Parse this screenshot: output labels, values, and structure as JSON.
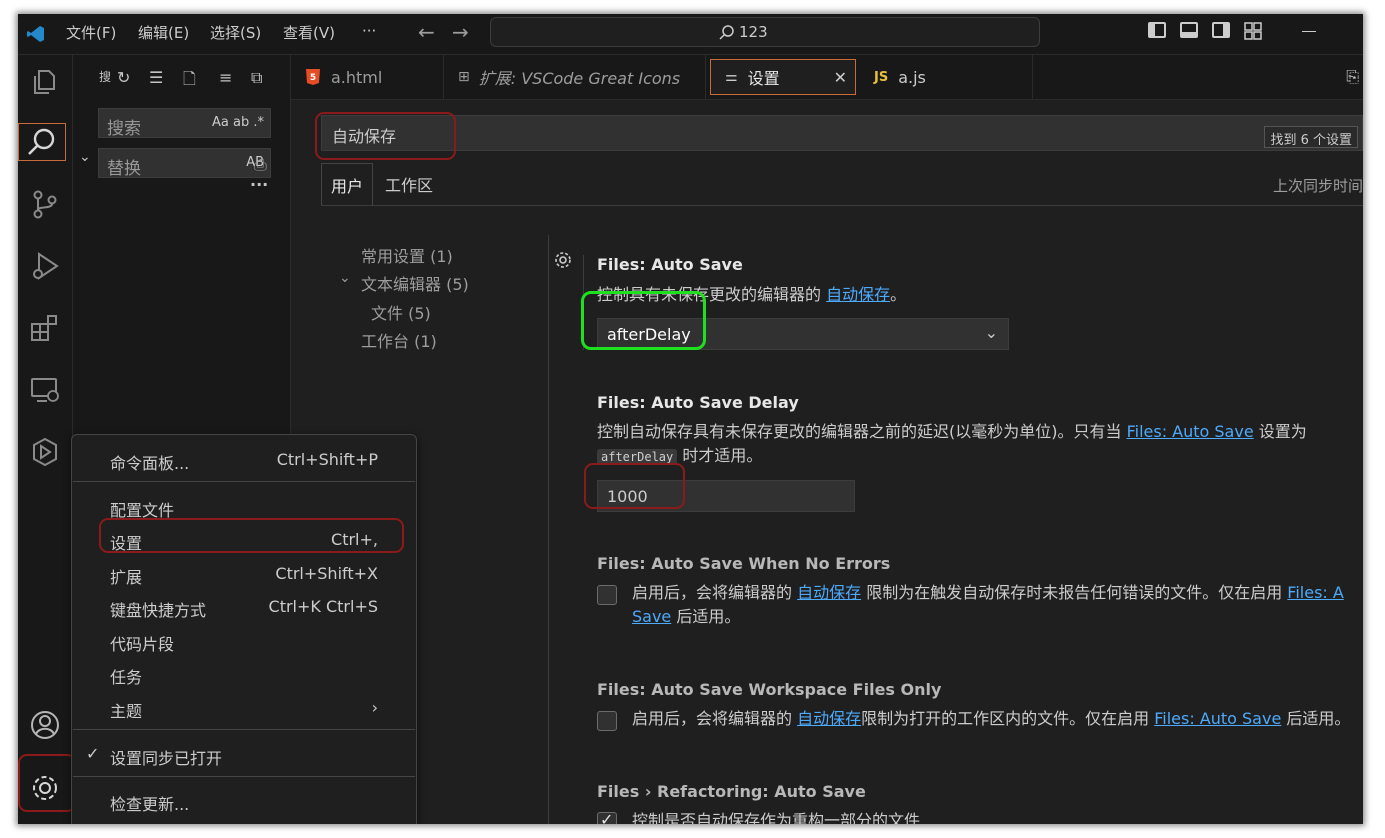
{
  "titlebar": {
    "menus": [
      "文件(F)",
      "编辑(E)",
      "选择(S)",
      "查看(V)",
      "···"
    ],
    "command_center": "123"
  },
  "sidebar": {
    "search_placeholder": "搜索",
    "search_options": "Aa  ab  .*",
    "replace_placeholder": "替换",
    "replace_option": "AB",
    "more": "···"
  },
  "tabs": [
    {
      "label": "a.html",
      "icon": "html5-icon"
    },
    {
      "label": "扩展: VSCode Great Icons",
      "icon": "extensions-icon"
    },
    {
      "label": "设置",
      "icon": "settings-sliders-icon",
      "close": "✕"
    },
    {
      "label": "a.js",
      "icon": "js-icon",
      "badge": "JS"
    }
  ],
  "settings": {
    "search_value": "自动保存",
    "found_count": "找到 6 个设置",
    "scope_tabs": [
      "用户",
      "工作区"
    ],
    "sync_text": "上次同步时间",
    "toc": [
      {
        "label": "常用设置 (1)"
      },
      {
        "label": "文本编辑器 (5)",
        "expanded": true
      },
      {
        "label": "文件 (5)"
      },
      {
        "label": "工作台 (1)"
      }
    ],
    "items": {
      "auto_save": {
        "title": "Files: Auto Save",
        "desc_prefix": "控制具有未保存更改的编辑器的 ",
        "desc_link": "自动保存",
        "desc_suffix": "。",
        "value": "afterDelay"
      },
      "auto_save_delay": {
        "title": "Files: Auto Save Delay",
        "desc_part1": "控制自动保存具有未保存更改的编辑器之前的延迟(以毫秒为单位)。只有当 ",
        "desc_link": "Files: Auto Save",
        "desc_part2": " 设置为",
        "desc_chip": "afterDelay",
        "desc_part3": " 时才适用。",
        "value": "1000"
      },
      "auto_save_no_errors": {
        "title": "Files: Auto Save When No Errors",
        "desc_part1": "启用后，会将编辑器的 ",
        "desc_link1": "自动保存",
        "desc_part2": " 限制为在触发自动保存时未报告任何错误的文件。仅在启用 ",
        "desc_link2a": "Files: A",
        "desc_link2b": "Save",
        "desc_part3": " 后适用。",
        "checked": false
      },
      "auto_save_workspace": {
        "title": "Files: Auto Save Workspace Files Only",
        "desc_part1": "启用后，会将编辑器的 ",
        "desc_link1": "自动保存",
        "desc_part2": "限制为打开的工作区内的文件。仅在启用 ",
        "desc_link2": "Files: Auto Save",
        "desc_part3": " 后适用。",
        "checked": false
      },
      "refactoring": {
        "title": "Files › Refactoring: Auto Save",
        "desc": "控制是否自动保存作为重构一部分的文件",
        "checked": true
      }
    }
  },
  "context_menu": {
    "items": [
      {
        "label": "命令面板...",
        "shortcut": "Ctrl+Shift+P"
      },
      {
        "label": "配置文件",
        "shortcut": ""
      },
      {
        "label": "设置",
        "shortcut": "Ctrl+,"
      },
      {
        "label": "扩展",
        "shortcut": "Ctrl+Shift+X"
      },
      {
        "label": "键盘快捷方式",
        "shortcut": "Ctrl+K Ctrl+S"
      },
      {
        "label": "代码片段",
        "shortcut": ""
      },
      {
        "label": "任务",
        "shortcut": ""
      },
      {
        "label": "主题",
        "shortcut": "›"
      },
      {
        "label": "设置同步已打开",
        "shortcut": "",
        "check": "✓"
      },
      {
        "label": "检查更新...",
        "shortcut": ""
      }
    ]
  },
  "colors": {
    "highlight_red": "#8b1a1a",
    "highlight_green": "#1fe01f",
    "link": "#4daafc",
    "background": "#1f1f1f"
  }
}
